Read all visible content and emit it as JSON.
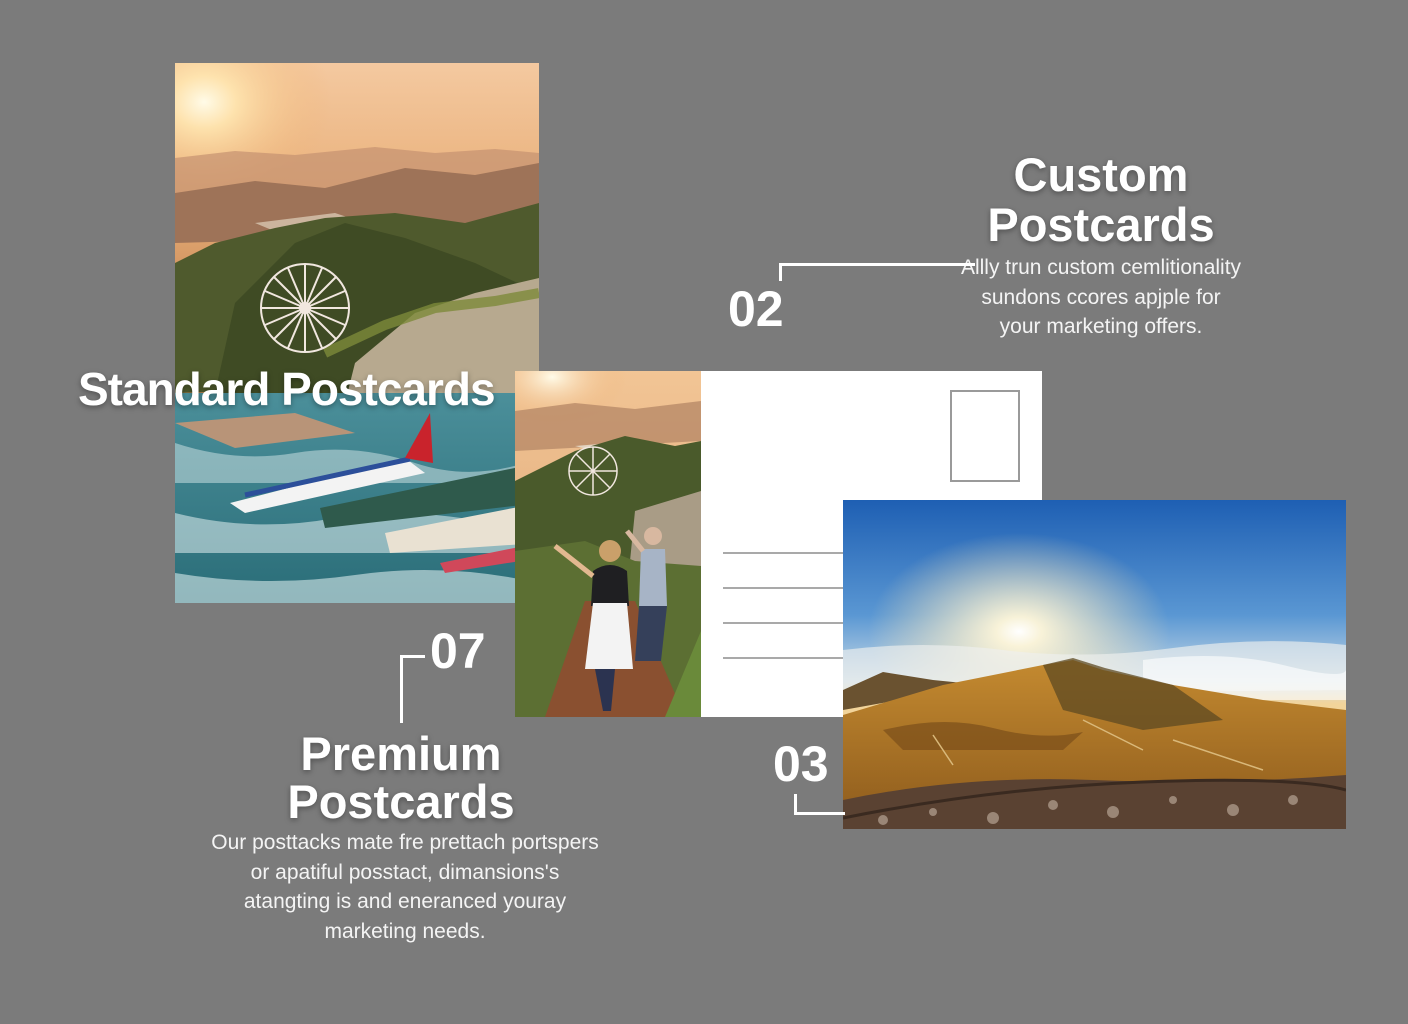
{
  "standard": {
    "title": "Standard Postcards"
  },
  "custom": {
    "number": "02",
    "title": "Custom Postcards",
    "description": "Allly trun custom cemlitionality sundons ccores apjple for your marketing offers."
  },
  "premium": {
    "number": "07",
    "title": "Premium Postcards",
    "description": "Our posttacks mate fre prettach portspers or apatiful posstact, dimansions's atangting is and eneranced youray marketing needs."
  },
  "landscape": {
    "number": "03"
  },
  "colors": {
    "background": "#7b7b7b",
    "text": "#ffffff"
  }
}
